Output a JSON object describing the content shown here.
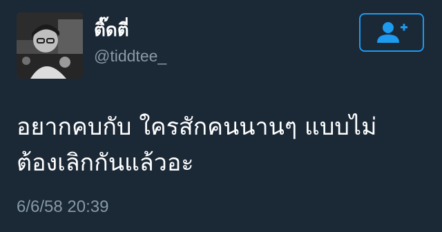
{
  "tweet": {
    "author": {
      "display_name": "ติ๊ดตี่",
      "handle": "@tiddtee_",
      "avatar_icon": "profile-photo"
    },
    "follow_button": {
      "icon": "add-user-icon"
    },
    "text_lines": [
      "อยากคบกับ ใครสักคนนานๆ แบบไม่",
      "ต้องเลิกกันแล้วอะ"
    ],
    "timestamp": "6/6/58 20:39"
  },
  "colors": {
    "background": "#1b2836",
    "text_primary": "#ffffff",
    "text_secondary": "#8899a6",
    "accent": "#1d9bf0"
  }
}
